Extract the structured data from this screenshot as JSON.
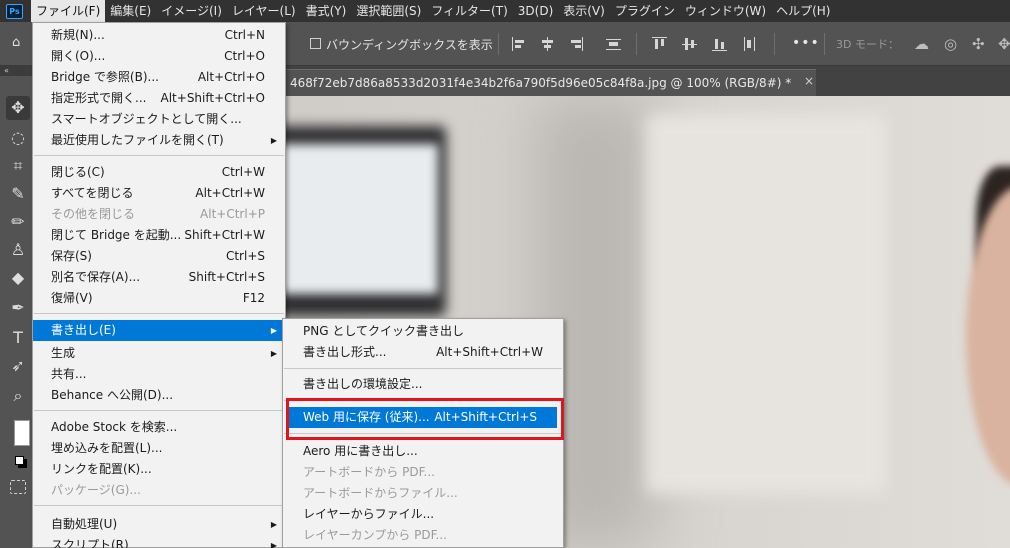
{
  "app": {
    "icon_text": "Ps"
  },
  "menubar": {
    "items": [
      {
        "label": "ファイル(F)"
      },
      {
        "label": "編集(E)"
      },
      {
        "label": "イメージ(I)"
      },
      {
        "label": "レイヤー(L)"
      },
      {
        "label": "書式(Y)"
      },
      {
        "label": "選択範囲(S)"
      },
      {
        "label": "フィルター(T)"
      },
      {
        "label": "3D(D)"
      },
      {
        "label": "表示(V)"
      },
      {
        "label": "プラグイン"
      },
      {
        "label": "ウィンドウ(W)"
      },
      {
        "label": "ヘルプ(H)"
      }
    ]
  },
  "options": {
    "bbox_label": "バウンディングボックスを表示",
    "mode_3d_label": "3D モード：",
    "more_glyph": "•••"
  },
  "document": {
    "tab_title": "468f72eb7d86a8533d2031f4e34b2f6a790f5d96e05c84f8a.jpg @ 100% (RGB/8#) *",
    "close_glyph": "×"
  },
  "file_menu": {
    "items": [
      {
        "label": "新規(N)...",
        "shortcut": "Ctrl+N"
      },
      {
        "label": "開く(O)...",
        "shortcut": "Ctrl+O"
      },
      {
        "label": "Bridge で参照(B)...",
        "shortcut": "Alt+Ctrl+O"
      },
      {
        "label": "指定形式で開く...",
        "shortcut": "Alt+Shift+Ctrl+O"
      },
      {
        "label": "スマートオブジェクトとして開く...",
        "shortcut": ""
      },
      {
        "label": "最近使用したファイルを開く(T)",
        "shortcut": ""
      },
      {
        "label": "閉じる(C)",
        "shortcut": "Ctrl+W"
      },
      {
        "label": "すべてを閉じる",
        "shortcut": "Alt+Ctrl+W"
      },
      {
        "label": "その他を閉じる",
        "shortcut": "Alt+Ctrl+P"
      },
      {
        "label": "閉じて Bridge を起動...",
        "shortcut": "Shift+Ctrl+W"
      },
      {
        "label": "保存(S)",
        "shortcut": "Ctrl+S"
      },
      {
        "label": "別名で保存(A)...",
        "shortcut": "Shift+Ctrl+S"
      },
      {
        "label": "復帰(V)",
        "shortcut": "F12"
      },
      {
        "label": "書き出し(E)",
        "shortcut": ""
      },
      {
        "label": "生成",
        "shortcut": ""
      },
      {
        "label": "共有...",
        "shortcut": ""
      },
      {
        "label": "Behance へ公開(D)...",
        "shortcut": ""
      },
      {
        "label": "Adobe Stock を検索...",
        "shortcut": ""
      },
      {
        "label": "埋め込みを配置(L)...",
        "shortcut": ""
      },
      {
        "label": "リンクを配置(K)...",
        "shortcut": ""
      },
      {
        "label": "パッケージ(G)...",
        "shortcut": ""
      },
      {
        "label": "自動処理(U)",
        "shortcut": ""
      },
      {
        "label": "スクリプト(R)",
        "shortcut": ""
      }
    ],
    "submenu_arrow": "▶"
  },
  "export_submenu": {
    "items": [
      {
        "label": "PNG としてクイック書き出し",
        "shortcut": ""
      },
      {
        "label": "書き出し形式...",
        "shortcut": "Alt+Shift+Ctrl+W"
      },
      {
        "label": "書き出しの環境設定...",
        "shortcut": ""
      },
      {
        "label": "Web 用に保存 (従来)...",
        "shortcut": "Alt+Shift+Ctrl+S"
      },
      {
        "label": "Aero 用に書き出し...",
        "shortcut": ""
      },
      {
        "label": "アートボードから PDF...",
        "shortcut": ""
      },
      {
        "label": "アートボードからファイル...",
        "shortcut": ""
      },
      {
        "label": "レイヤーからファイル...",
        "shortcut": ""
      },
      {
        "label": "レイヤーカンプから PDF...",
        "shortcut": ""
      }
    ]
  },
  "colors": {
    "highlight": "#0078d7",
    "annotation_box": "#e0141c",
    "menubar_bg": "#323232"
  }
}
